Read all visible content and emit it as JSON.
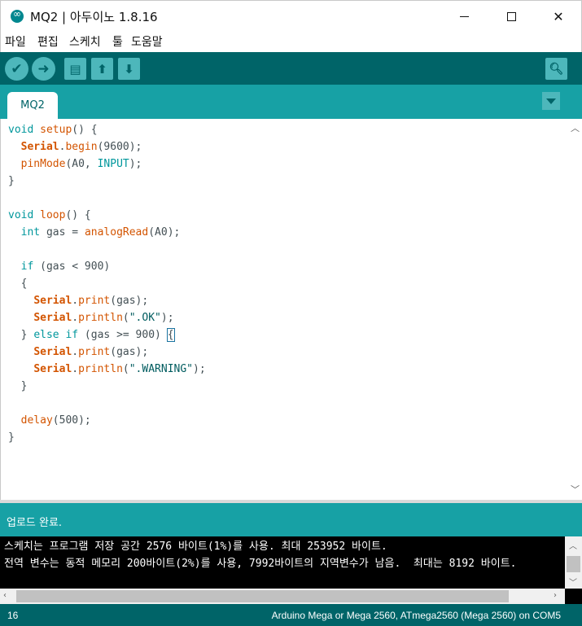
{
  "window": {
    "title": "MQ2 | 아두이노 1.8.16"
  },
  "menu": [
    "파일",
    "편집",
    "스케치",
    "툴",
    "도움말"
  ],
  "toolbar": {
    "buttons": [
      "verify",
      "upload",
      "new",
      "open",
      "save"
    ],
    "serial_monitor": "serial-monitor"
  },
  "tabs": [
    {
      "label": "MQ2"
    }
  ],
  "editor": {
    "lines": [
      "void setup() {",
      "  Serial.begin(9600);",
      "  pinMode(A0, INPUT);",
      "}",
      "",
      "void loop() {",
      "  int gas = analogRead(A0);",
      "",
      "  if (gas < 900)",
      "  {",
      "    Serial.print(gas);",
      "    Serial.println(\".OK\");",
      "  } else if (gas >= 900) {",
      "    Serial.print(gas);",
      "    Serial.println(\".WARNING\");",
      "  }",
      "",
      "  delay(500);",
      "}"
    ]
  },
  "status": {
    "message": "업로드 완료."
  },
  "console": {
    "lines": [
      "스케치는 프로그램 저장 공간 2576 바이트(1%)를 사용. 최대 253952 바이트.",
      "전역 변수는 동적 메모리 200바이트(2%)를 사용, 7992바이트의 지역변수가 남음.  최대는 8192 바이트."
    ]
  },
  "footer": {
    "line_number": "16",
    "board": "Arduino Mega or Mega 2560, ATmega2560 (Mega 2560) on COM5"
  },
  "colors": {
    "toolbar": "#006468",
    "tabbar": "#17a1a5",
    "button": "#4db7bb",
    "keyword": "#00979c",
    "function": "#d35400"
  }
}
